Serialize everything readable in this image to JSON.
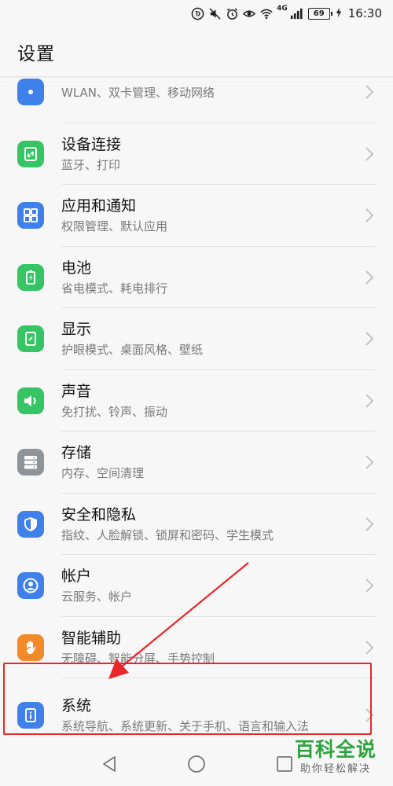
{
  "status_bar": {
    "network": "4G",
    "battery": "69",
    "time": "16:30",
    "icons": [
      "hd-call-icon",
      "mute-icon",
      "alarm-icon",
      "eye-comfort-icon",
      "wifi-icon",
      "signal-icon",
      "battery-icon",
      "charging-icon"
    ]
  },
  "header": {
    "title": "设置"
  },
  "settings": [
    {
      "title": "",
      "subtitle": "WLAN、双卡管理、移动网络",
      "icon": "network-icon",
      "color": "#3f80ea"
    },
    {
      "title": "设备连接",
      "subtitle": "蓝牙、打印",
      "icon": "device-connection-icon",
      "color": "#35c565"
    },
    {
      "title": "应用和通知",
      "subtitle": "权限管理、默认应用",
      "icon": "apps-icon",
      "color": "#3f80ea"
    },
    {
      "title": "电池",
      "subtitle": "省电模式、耗电排行",
      "icon": "battery-icon",
      "color": "#35c565"
    },
    {
      "title": "显示",
      "subtitle": "护眼模式、桌面风格、壁纸",
      "icon": "display-icon",
      "color": "#35c565"
    },
    {
      "title": "声音",
      "subtitle": "免打扰、铃声、振动",
      "icon": "speaker-icon",
      "color": "#35c565"
    },
    {
      "title": "存储",
      "subtitle": "内存、空间清理",
      "icon": "storage-icon",
      "color": "#8f9499"
    },
    {
      "title": "安全和隐私",
      "subtitle": "指纹、人脸解锁、锁屏和密码、学生模式",
      "icon": "shield-icon",
      "color": "#3f80ea"
    },
    {
      "title": "帐户",
      "subtitle": "云服务、帐户",
      "icon": "account-icon",
      "color": "#3f80ea"
    },
    {
      "title": "智能辅助",
      "subtitle": "无障碍、智能分屏、手势控制",
      "icon": "hand-icon",
      "color": "#f28a2a"
    },
    {
      "title": "系统",
      "subtitle": "系统导航、系统更新、关于手机、语言和输入法",
      "icon": "system-info-icon",
      "color": "#3f80ea"
    }
  ],
  "annotation": {
    "highlight_color": "#e8282a"
  },
  "nav_bar": {
    "buttons": [
      "back-icon",
      "home-icon",
      "recent-apps-icon"
    ]
  },
  "watermark": {
    "title": "百科全说",
    "subtitle": "助你轻松解决"
  }
}
